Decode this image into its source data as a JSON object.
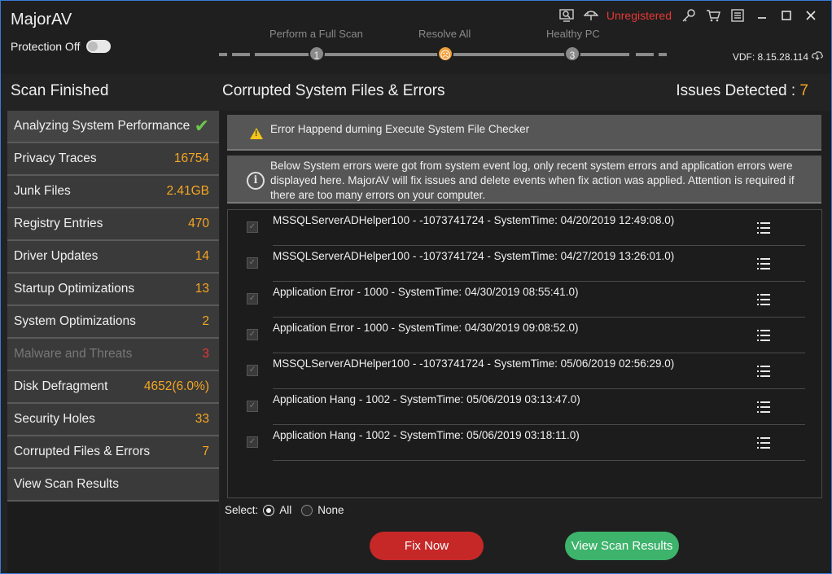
{
  "app": {
    "title": "MajorAV",
    "protection_label": "Protection Off"
  },
  "steps": [
    "Perform a Full Scan",
    "Resolve All",
    "Healthy PC"
  ],
  "step_numbers": [
    "1",
    "☹",
    "3"
  ],
  "toolbar": {
    "unregistered": "Unregistered",
    "icons": [
      "scan-zoom-icon",
      "umbrella-icon",
      "key-icon",
      "cart-icon",
      "menu-icon",
      "minimize-icon",
      "maximize-icon",
      "close-icon"
    ]
  },
  "vdf": "VDF: 8.15.28.114",
  "left_heading": "Scan Finished",
  "main_heading": "Corrupted System Files & Errors",
  "issues": {
    "label": "Issues Detected : ",
    "count": "7"
  },
  "sidebar": [
    {
      "label": "Analyzing System Performance",
      "value": "✔"
    },
    {
      "label": "Privacy Traces",
      "value": "16754"
    },
    {
      "label": "Junk Files",
      "value": "2.41GB"
    },
    {
      "label": "Registry Entries",
      "value": "470"
    },
    {
      "label": "Driver Updates",
      "value": "14"
    },
    {
      "label": "Startup Optimizations",
      "value": "13"
    },
    {
      "label": "System Optimizations",
      "value": "2"
    },
    {
      "label": "Malware and Threats",
      "value": "3"
    },
    {
      "label": "Disk Defragment",
      "value": "4652(6.0%)"
    },
    {
      "label": "Security Holes",
      "value": "33"
    },
    {
      "label": "Corrupted Files & Errors",
      "value": "7"
    },
    {
      "label": "View Scan Results",
      "value": ""
    }
  ],
  "alert_text": "Error Happend durning Execute System File Checker",
  "info_text": "Below System errors were got from system event log, only recent system errors and application errors were displayed here. MajorAV will fix issues and delete events when fix action was applied. Attention is required if there are too many errors on your computer.",
  "errors": [
    "MSSQLServerADHelper100 - -1073741724 - SystemTime: 04/20/2019 12:49:08.0)",
    "MSSQLServerADHelper100 - -1073741724 - SystemTime: 04/27/2019 13:26:01.0)",
    "Application Error - 1000 - SystemTime: 04/30/2019 08:55:41.0)",
    "Application Error - 1000 - SystemTime: 04/30/2019 09:08:52.0)",
    "MSSQLServerADHelper100 - -1073741724 - SystemTime: 05/06/2019 02:56:29.0)",
    "Application Hang - 1002 - SystemTime: 05/06/2019 03:13:47.0)",
    "Application Hang - 1002 - SystemTime: 05/06/2019 03:18:11.0)"
  ],
  "select": {
    "label": "Select:",
    "all": "All",
    "none": "None",
    "selected": "All"
  },
  "buttons": {
    "fix": "Fix Now",
    "results": "View Scan Results"
  },
  "colors": {
    "accent_orange": "#f5a623",
    "danger_red": "#c62828",
    "success_green": "#3db36b",
    "check_green": "#6ec64b"
  }
}
